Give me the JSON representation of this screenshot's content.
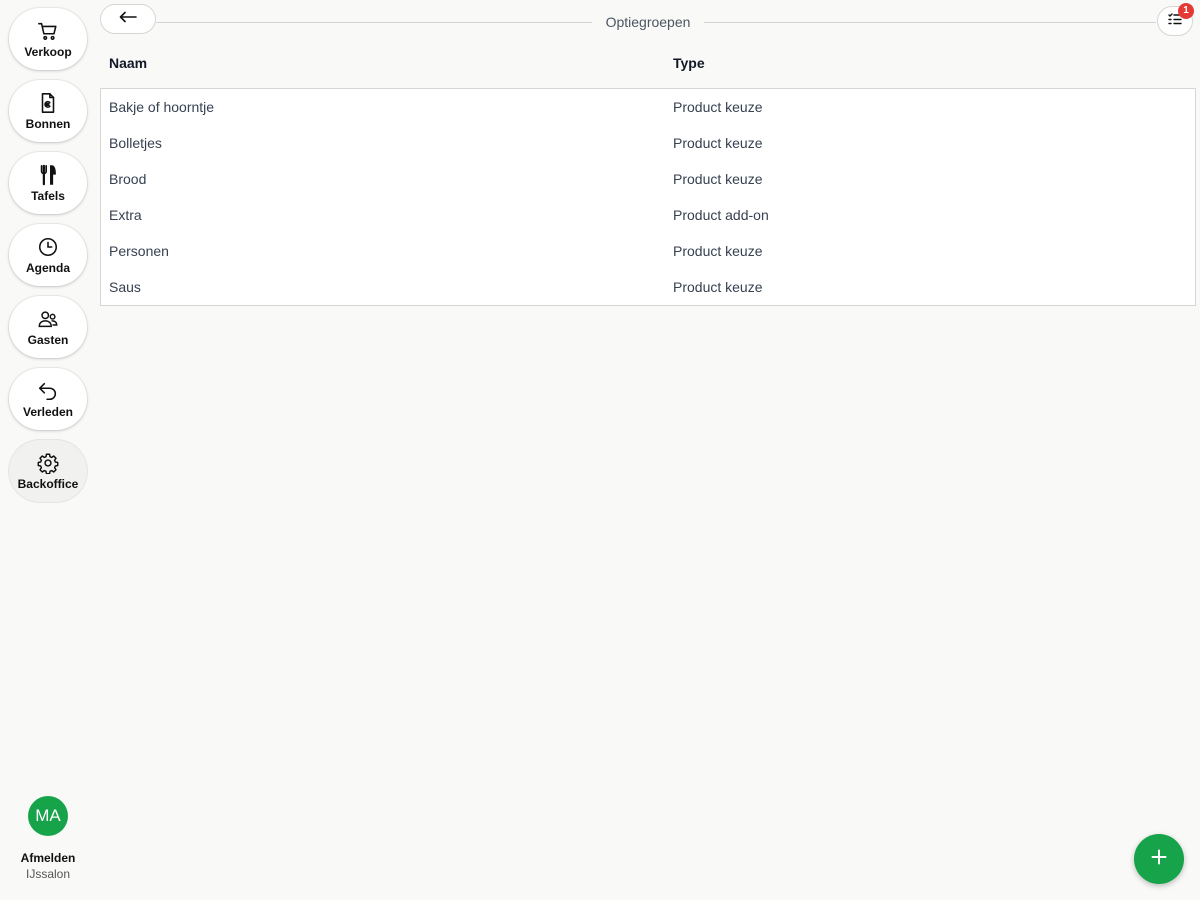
{
  "sidebar": {
    "items": [
      {
        "label": "Verkoop",
        "icon": "cart-icon"
      },
      {
        "label": "Bonnen",
        "icon": "receipt-euro-icon"
      },
      {
        "label": "Tafels",
        "icon": "cutlery-icon"
      },
      {
        "label": "Agenda",
        "icon": "clock-icon"
      },
      {
        "label": "Gasten",
        "icon": "users-icon"
      },
      {
        "label": "Verleden",
        "icon": "undo-icon"
      },
      {
        "label": "Backoffice",
        "icon": "gear-icon",
        "active": true
      }
    ],
    "profile": {
      "initials": "MA",
      "logout_label": "Afmelden",
      "store_name": "IJssalon",
      "avatar_color": "#16a34a"
    }
  },
  "header": {
    "title": "Optiegroepen",
    "back_icon": "arrow-left-icon",
    "tasks_icon": "checklist-icon",
    "tasks_badge": "1",
    "badge_color": "#e53935"
  },
  "table": {
    "columns": [
      "Naam",
      "Type"
    ],
    "rows": [
      {
        "name": "Bakje of hoorntje",
        "type": "Product keuze"
      },
      {
        "name": "Bolletjes",
        "type": "Product keuze"
      },
      {
        "name": "Brood",
        "type": "Product keuze"
      },
      {
        "name": "Extra",
        "type": "Product add-on"
      },
      {
        "name": "Personen",
        "type": "Product keuze"
      },
      {
        "name": "Saus",
        "type": "Product keuze"
      }
    ]
  },
  "fab": {
    "icon": "plus-icon",
    "color": "#16a34a"
  }
}
